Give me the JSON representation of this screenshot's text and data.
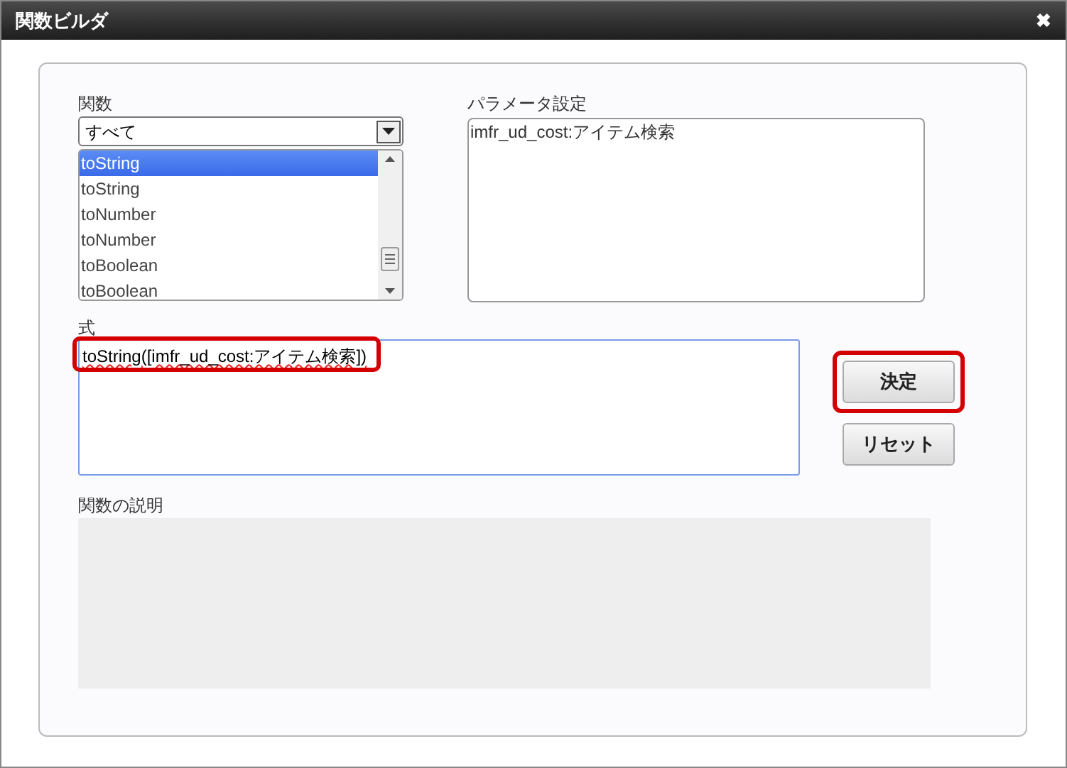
{
  "window": {
    "title": "関数ビルダ",
    "close": "✖"
  },
  "function_picker": {
    "label": "関数",
    "category": "すべて",
    "items": [
      {
        "label": "toString",
        "selected": true
      },
      {
        "label": "toString",
        "selected": false
      },
      {
        "label": "toNumber",
        "selected": false
      },
      {
        "label": "toNumber",
        "selected": false
      },
      {
        "label": "toBoolean",
        "selected": false
      },
      {
        "label": "toBoolean",
        "selected": false
      }
    ]
  },
  "parameters": {
    "label": "パラメータ設定",
    "value": "imfr_ud_cost:アイテム検索"
  },
  "expression": {
    "label": "式",
    "value": "toString([imfr_ud_cost:アイテム検索])",
    "highlighted": true
  },
  "buttons": [
    {
      "label": "決定",
      "highlighted": true
    },
    {
      "label": "リセット",
      "highlighted": false
    }
  ],
  "description": {
    "label": "関数の説明"
  }
}
